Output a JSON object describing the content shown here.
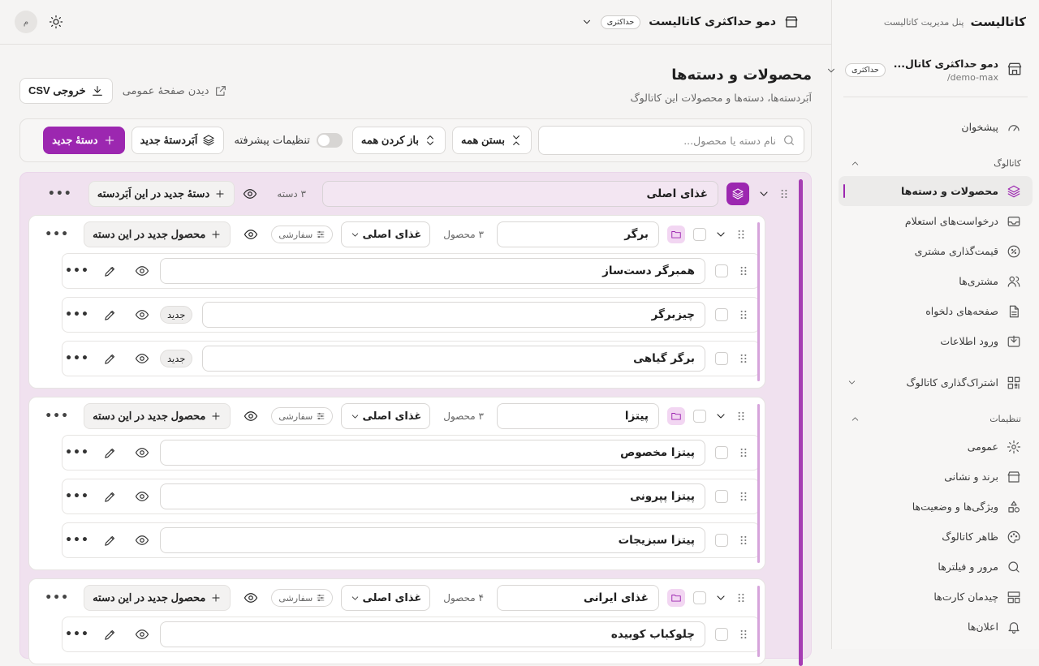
{
  "sidebar": {
    "brand": "کاتالیست",
    "brand_sub": "پنل مدیریت کاتالیست",
    "workspace": {
      "name": "دمو حداکثری کاتال...",
      "slug": "/demo-max",
      "plan": "حداکثری"
    },
    "items_top": [
      {
        "label": "پیشخوان",
        "icon": "gauge-icon"
      }
    ],
    "catalog_section": "کاتالوگ",
    "catalog_items": [
      {
        "label": "محصولات و دسته‌ها",
        "icon": "layers-icon",
        "active": true
      },
      {
        "label": "درخواست‌های استعلام",
        "icon": "inbox-icon"
      },
      {
        "label": "قیمت‌گذاری مشتری",
        "icon": "percent-icon"
      },
      {
        "label": "مشتری‌ها",
        "icon": "users-icon"
      },
      {
        "label": "صفحه‌های دلخواه",
        "icon": "file-icon"
      },
      {
        "label": "ورود اطلاعات",
        "icon": "import-icon"
      }
    ],
    "share": {
      "label": "اشتراک‌گذاری کاتالوگ",
      "icon": "qr-icon"
    },
    "settings_section": "تنظیمات",
    "settings_items": [
      {
        "label": "عمومی",
        "icon": "gear-icon"
      },
      {
        "label": "برند و نشانی",
        "icon": "store-icon"
      },
      {
        "label": "ویژگی‌ها و وضعیت‌ها",
        "icon": "shapes-icon"
      },
      {
        "label": "ظاهر کاتالوگ",
        "icon": "palette-icon"
      },
      {
        "label": "مرور و فیلترها",
        "icon": "search-icon"
      },
      {
        "label": "چیدمان کارت‌ها",
        "icon": "layout-icon"
      },
      {
        "label": "اعلان‌ها",
        "icon": "bell-icon"
      }
    ]
  },
  "topbar": {
    "title": "دمو حداکثری کاتالیست",
    "plan": "حداکثری",
    "avatar": "م"
  },
  "page": {
    "title": "محصولات و دسته‌ها",
    "subtitle": "اَبَردسته‌ها، دسته‌ها و محصولات این کاتالوگ",
    "public_link": "دیدن صفحهٔ عمومی",
    "export": "خروجی CSV"
  },
  "toolbar": {
    "search_placeholder": "نام دسته یا محصول...",
    "collapse_all": "بستن همه",
    "expand_all": "باز کردن همه",
    "advanced": "تنظیمات پیشرفته",
    "new_super": "اَبَردستهٔ جدید",
    "new_cat": "دستهٔ جدید"
  },
  "supercat": {
    "name": "غذای اصلی",
    "count": "۳ دسته",
    "add_label": "دستهٔ جدید در این اَبَردسته",
    "categories": [
      {
        "name": "برگر",
        "count": "۳ محصول",
        "parent": "غذای اصلی",
        "sort": "سفارشی",
        "add_label": "محصول جدید در این دسته",
        "products": [
          {
            "name": "همبرگر دست‌ساز",
            "tag": ""
          },
          {
            "name": "چیزبرگر",
            "tag": "جدید"
          },
          {
            "name": "برگر گیاهی",
            "tag": "جدید"
          }
        ]
      },
      {
        "name": "پیتزا",
        "count": "۳ محصول",
        "parent": "غذای اصلی",
        "sort": "سفارشی",
        "add_label": "محصول جدید در این دسته",
        "products": [
          {
            "name": "پیتزا مخصوص",
            "tag": ""
          },
          {
            "name": "پیتزا پپرونی",
            "tag": ""
          },
          {
            "name": "پیتزا سبزیجات",
            "tag": ""
          }
        ]
      },
      {
        "name": "غذای ایرانی",
        "count": "۴ محصول",
        "parent": "غذای اصلی",
        "sort": "سفارشی",
        "add_label": "محصول جدید در این دسته",
        "products": [
          {
            "name": "چلوکباب کوبیده",
            "tag": ""
          }
        ]
      }
    ]
  }
}
